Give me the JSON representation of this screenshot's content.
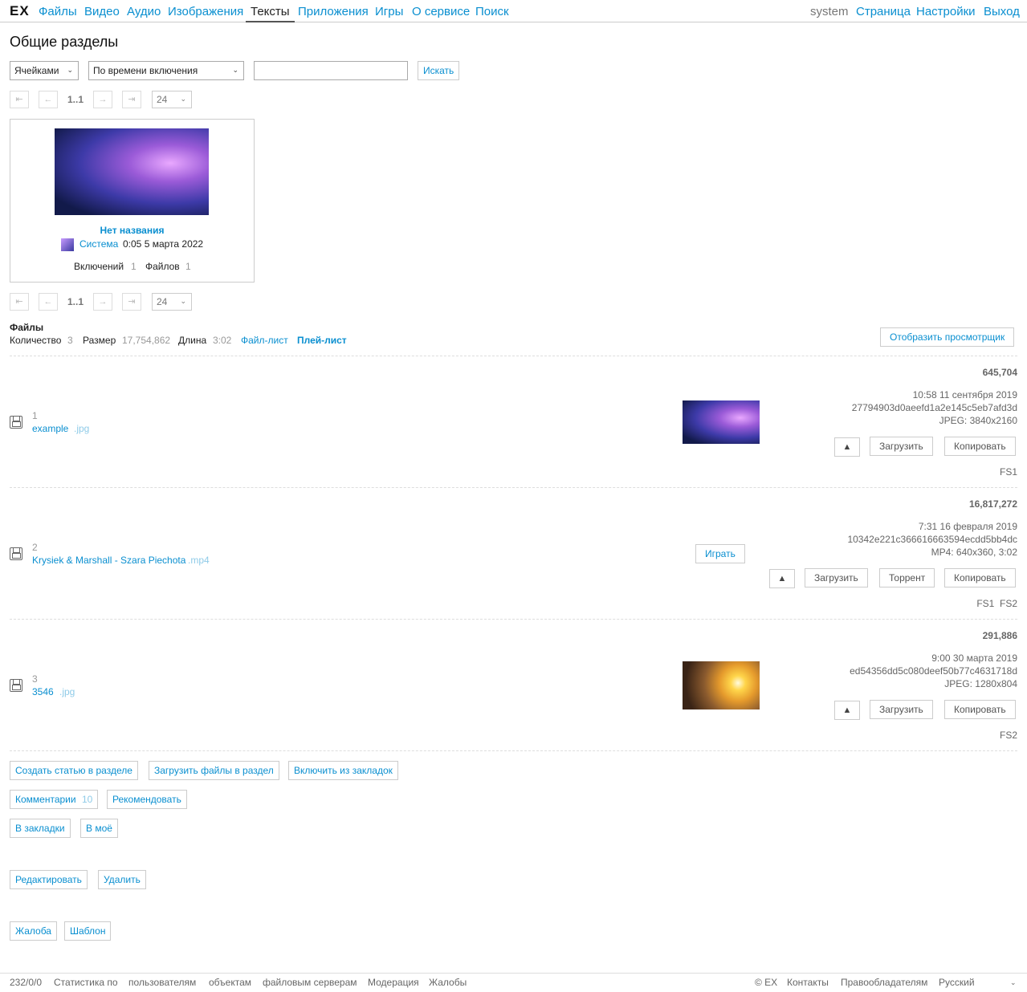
{
  "header": {
    "logo": "EX",
    "nav": [
      "Файлы",
      "Видео",
      "Аудио",
      "Изображения",
      "Тексты",
      "Приложения",
      "Игры",
      "О сервисе",
      "Поиск"
    ],
    "active_nav": "Тексты",
    "user": "system",
    "right": [
      "Страница",
      "Настройки",
      "Выход"
    ]
  },
  "page_title": "Общие разделы",
  "filters": {
    "view": "Ячейками",
    "sort": "По времени включения",
    "search_value": "",
    "search_button": "Искать"
  },
  "pager": {
    "range": "1..1",
    "per_page": "24"
  },
  "card": {
    "title": "Нет названия",
    "author": "Система",
    "date": "0:05 5 марта 2022",
    "includes_label": "Включений",
    "includes": "1",
    "files_label": "Файлов",
    "files": "1"
  },
  "files_summary": {
    "heading": "Файлы",
    "count_label": "Количество",
    "count": "3",
    "size_label": "Размер",
    "size": "17,754,862",
    "length_label": "Длина",
    "length": "3:02",
    "filelist": "Файл-лист",
    "playlist": "Плей-лист",
    "viewer_button": "Отобразить просмотрщик"
  },
  "files": [
    {
      "index": "1",
      "name": "example",
      "ext": ".jpg",
      "size": "645,704",
      "date": "10:58 11 сентября 2019",
      "hash": "27794903d0aeefd1a2e145c5eb7afd3d",
      "info": "JPEG: 3840x2160",
      "servers": "FS1",
      "buttons": [
        "Загрузить",
        "Копировать"
      ]
    },
    {
      "index": "2",
      "name": "Krysiek & Marshall - Szara Piechota",
      "ext": ".mp4",
      "size": "16,817,272",
      "date": "7:31 16 февраля 2019",
      "hash": "10342e221c366616663594ecdd5bb4dc",
      "info": "MP4: 640x360, 3:02",
      "servers": "FS1  FS2",
      "play": "Играть",
      "buttons": [
        "Загрузить",
        "Торрент",
        "Копировать"
      ]
    },
    {
      "index": "3",
      "name": "3546",
      "ext": ".jpg",
      "size": "291,886",
      "date": "9:00 30 марта 2019",
      "hash": "ed54356dd5c080deef50b77c4631718d",
      "info": "JPEG: 1280x804",
      "servers": "FS2",
      "buttons": [
        "Загрузить",
        "Копировать"
      ]
    }
  ],
  "actions": {
    "create_article": "Создать статью в разделе",
    "upload_files": "Загрузить файлы в раздел",
    "include_bookmarks": "Включить из закладок",
    "comments": "Комментарии",
    "comments_count": "10",
    "recommend": "Рекомендовать",
    "to_bookmarks": "В закладки",
    "to_mine": "В моё",
    "edit": "Редактировать",
    "delete": "Удалить",
    "complaint": "Жалоба",
    "template": "Шаблон"
  },
  "footer": {
    "stats": "232/0/0",
    "stats_by": "Статистика по",
    "users": "пользователям",
    "objects": "объектам",
    "file_servers": "файловым серверам",
    "moderation": "Модерация",
    "complaints": "Жалобы",
    "copyright": "© EX",
    "contacts": "Контакты",
    "rightholders": "Правообладателям",
    "language": "Русский"
  }
}
